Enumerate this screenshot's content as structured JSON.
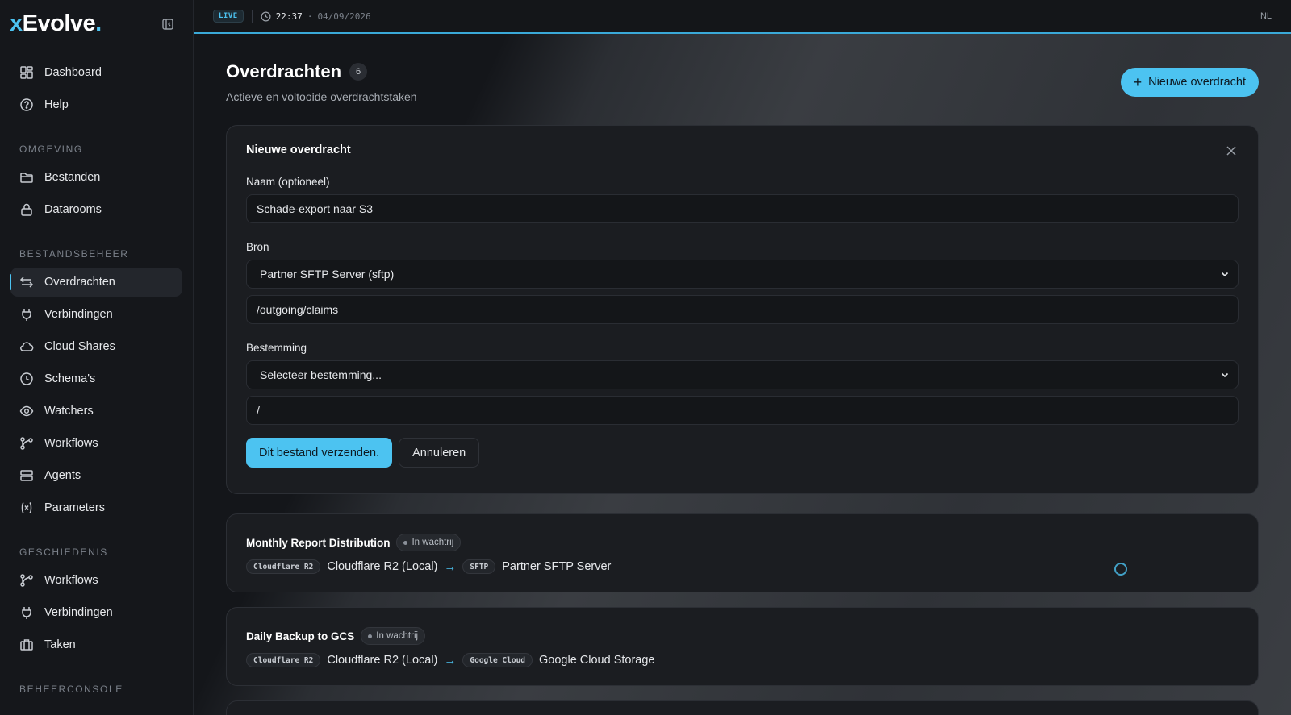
{
  "brand": {
    "prefix": "x",
    "name": "Evolve",
    "suffix": "."
  },
  "topbar": {
    "live": "LIVE",
    "time": "22:37",
    "separator": "·",
    "date": "04/09/2026",
    "lang": "NL"
  },
  "sidebar": {
    "top": [
      {
        "label": "Dashboard",
        "icon": "dashboard-icon"
      },
      {
        "label": "Help",
        "icon": "help-icon"
      }
    ],
    "sections": [
      {
        "title": "OMGEVING",
        "items": [
          {
            "label": "Bestanden",
            "icon": "folder-icon"
          },
          {
            "label": "Datarooms",
            "icon": "lock-icon"
          }
        ]
      },
      {
        "title": "BESTANDSBEHEER",
        "items": [
          {
            "label": "Overdrachten",
            "icon": "transfer-icon",
            "active": true
          },
          {
            "label": "Verbindingen",
            "icon": "plug-icon"
          },
          {
            "label": "Cloud Shares",
            "icon": "cloud-icon"
          },
          {
            "label": "Schema's",
            "icon": "clock-icon"
          },
          {
            "label": "Watchers",
            "icon": "eye-icon"
          },
          {
            "label": "Workflows",
            "icon": "workflow-icon"
          },
          {
            "label": "Agents",
            "icon": "server-icon"
          },
          {
            "label": "Parameters",
            "icon": "variable-icon"
          }
        ]
      },
      {
        "title": "GESCHIEDENIS",
        "items": [
          {
            "label": "Workflows",
            "icon": "workflow-icon"
          },
          {
            "label": "Verbindingen",
            "icon": "plug-icon"
          },
          {
            "label": "Taken",
            "icon": "briefcase-icon"
          }
        ]
      },
      {
        "title": "BEHEERCONSOLE",
        "items": []
      }
    ]
  },
  "page": {
    "title": "Overdrachten",
    "count": "6",
    "subtitle": "Actieve en voltooide overdrachtstaken",
    "new_button": "Nieuwe overdracht"
  },
  "form": {
    "title": "Nieuwe overdracht",
    "name_label": "Naam (optioneel)",
    "name_value": "Schade-export naar S3",
    "source_label": "Bron",
    "source_value": "Partner SFTP Server (sftp)",
    "source_path": "/outgoing/claims",
    "dest_label": "Bestemming",
    "dest_value": "Selecteer bestemming...",
    "dest_path": "/",
    "submit": "Dit bestand verzenden.",
    "cancel": "Annuleren"
  },
  "transfers": [
    {
      "name": "Monthly Report Distribution",
      "status": "In wachtrij",
      "from_tag": "Cloudflare R2",
      "from": "Cloudflare R2 (Local)",
      "to_tag": "SFTP",
      "to": "Partner SFTP Server"
    },
    {
      "name": "Daily Backup to GCS",
      "status": "In wachtrij",
      "from_tag": "Cloudflare R2",
      "from": "Cloudflare R2 (Local)",
      "to_tag": "Google Cloud",
      "to": "Google Cloud Storage"
    }
  ],
  "colors": {
    "accent": "#4cc3f1",
    "background": "#121418",
    "card": "#1b1d21"
  }
}
